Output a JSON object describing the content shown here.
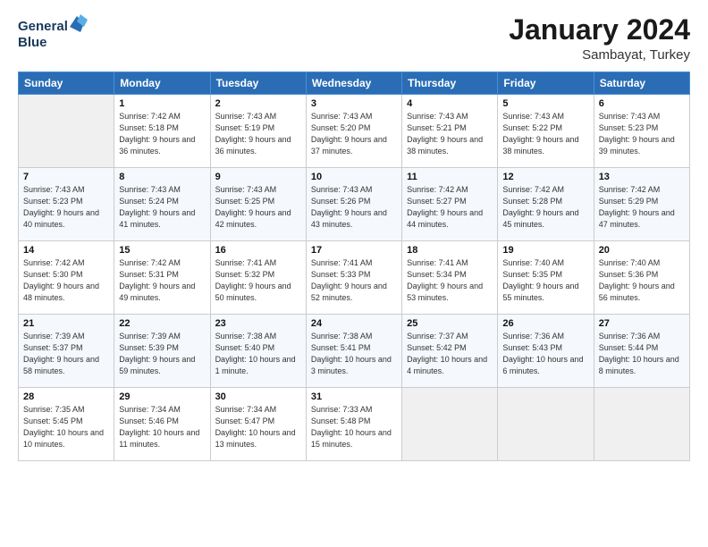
{
  "header": {
    "logo_line1": "General",
    "logo_line2": "Blue",
    "month_year": "January 2024",
    "location": "Sambayat, Turkey"
  },
  "weekdays": [
    "Sunday",
    "Monday",
    "Tuesday",
    "Wednesday",
    "Thursday",
    "Friday",
    "Saturday"
  ],
  "weeks": [
    [
      {
        "day": "",
        "empty": true
      },
      {
        "day": "1",
        "sunrise": "7:42 AM",
        "sunset": "5:18 PM",
        "daylight": "9 hours and 36 minutes."
      },
      {
        "day": "2",
        "sunrise": "7:43 AM",
        "sunset": "5:19 PM",
        "daylight": "9 hours and 36 minutes."
      },
      {
        "day": "3",
        "sunrise": "7:43 AM",
        "sunset": "5:20 PM",
        "daylight": "9 hours and 37 minutes."
      },
      {
        "day": "4",
        "sunrise": "7:43 AM",
        "sunset": "5:21 PM",
        "daylight": "9 hours and 38 minutes."
      },
      {
        "day": "5",
        "sunrise": "7:43 AM",
        "sunset": "5:22 PM",
        "daylight": "9 hours and 38 minutes."
      },
      {
        "day": "6",
        "sunrise": "7:43 AM",
        "sunset": "5:23 PM",
        "daylight": "9 hours and 39 minutes."
      }
    ],
    [
      {
        "day": "7",
        "sunrise": "7:43 AM",
        "sunset": "5:23 PM",
        "daylight": "9 hours and 40 minutes."
      },
      {
        "day": "8",
        "sunrise": "7:43 AM",
        "sunset": "5:24 PM",
        "daylight": "9 hours and 41 minutes."
      },
      {
        "day": "9",
        "sunrise": "7:43 AM",
        "sunset": "5:25 PM",
        "daylight": "9 hours and 42 minutes."
      },
      {
        "day": "10",
        "sunrise": "7:43 AM",
        "sunset": "5:26 PM",
        "daylight": "9 hours and 43 minutes."
      },
      {
        "day": "11",
        "sunrise": "7:42 AM",
        "sunset": "5:27 PM",
        "daylight": "9 hours and 44 minutes."
      },
      {
        "day": "12",
        "sunrise": "7:42 AM",
        "sunset": "5:28 PM",
        "daylight": "9 hours and 45 minutes."
      },
      {
        "day": "13",
        "sunrise": "7:42 AM",
        "sunset": "5:29 PM",
        "daylight": "9 hours and 47 minutes."
      }
    ],
    [
      {
        "day": "14",
        "sunrise": "7:42 AM",
        "sunset": "5:30 PM",
        "daylight": "9 hours and 48 minutes."
      },
      {
        "day": "15",
        "sunrise": "7:42 AM",
        "sunset": "5:31 PM",
        "daylight": "9 hours and 49 minutes."
      },
      {
        "day": "16",
        "sunrise": "7:41 AM",
        "sunset": "5:32 PM",
        "daylight": "9 hours and 50 minutes."
      },
      {
        "day": "17",
        "sunrise": "7:41 AM",
        "sunset": "5:33 PM",
        "daylight": "9 hours and 52 minutes."
      },
      {
        "day": "18",
        "sunrise": "7:41 AM",
        "sunset": "5:34 PM",
        "daylight": "9 hours and 53 minutes."
      },
      {
        "day": "19",
        "sunrise": "7:40 AM",
        "sunset": "5:35 PM",
        "daylight": "9 hours and 55 minutes."
      },
      {
        "day": "20",
        "sunrise": "7:40 AM",
        "sunset": "5:36 PM",
        "daylight": "9 hours and 56 minutes."
      }
    ],
    [
      {
        "day": "21",
        "sunrise": "7:39 AM",
        "sunset": "5:37 PM",
        "daylight": "9 hours and 58 minutes."
      },
      {
        "day": "22",
        "sunrise": "7:39 AM",
        "sunset": "5:39 PM",
        "daylight": "9 hours and 59 minutes."
      },
      {
        "day": "23",
        "sunrise": "7:38 AM",
        "sunset": "5:40 PM",
        "daylight": "10 hours and 1 minute."
      },
      {
        "day": "24",
        "sunrise": "7:38 AM",
        "sunset": "5:41 PM",
        "daylight": "10 hours and 3 minutes."
      },
      {
        "day": "25",
        "sunrise": "7:37 AM",
        "sunset": "5:42 PM",
        "daylight": "10 hours and 4 minutes."
      },
      {
        "day": "26",
        "sunrise": "7:36 AM",
        "sunset": "5:43 PM",
        "daylight": "10 hours and 6 minutes."
      },
      {
        "day": "27",
        "sunrise": "7:36 AM",
        "sunset": "5:44 PM",
        "daylight": "10 hours and 8 minutes."
      }
    ],
    [
      {
        "day": "28",
        "sunrise": "7:35 AM",
        "sunset": "5:45 PM",
        "daylight": "10 hours and 10 minutes."
      },
      {
        "day": "29",
        "sunrise": "7:34 AM",
        "sunset": "5:46 PM",
        "daylight": "10 hours and 11 minutes."
      },
      {
        "day": "30",
        "sunrise": "7:34 AM",
        "sunset": "5:47 PM",
        "daylight": "10 hours and 13 minutes."
      },
      {
        "day": "31",
        "sunrise": "7:33 AM",
        "sunset": "5:48 PM",
        "daylight": "10 hours and 15 minutes."
      },
      {
        "day": "",
        "empty": true
      },
      {
        "day": "",
        "empty": true
      },
      {
        "day": "",
        "empty": true
      }
    ]
  ]
}
